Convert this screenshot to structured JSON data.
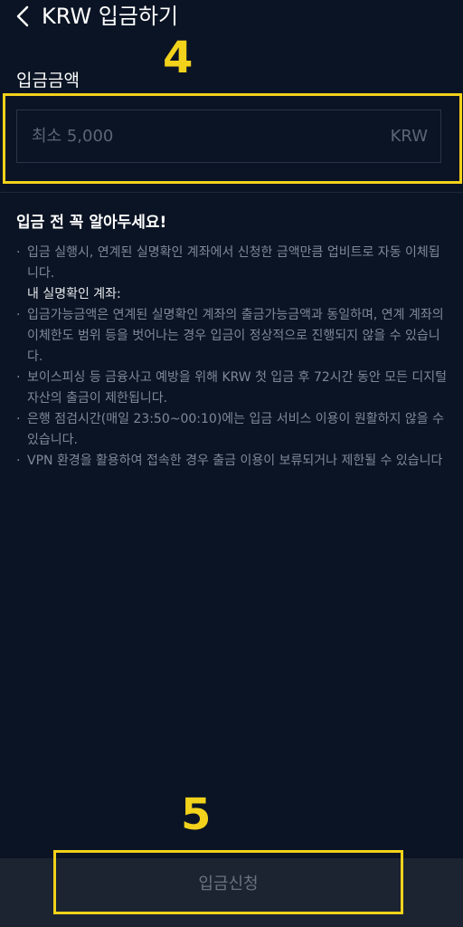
{
  "header": {
    "back_icon": "chevron-left-icon",
    "title": "KRW 입금하기"
  },
  "amount": {
    "label": "입금금액",
    "placeholder": "최소 5,000",
    "unit": "KRW"
  },
  "annotations": {
    "amount_step": "4",
    "submit_step": "5",
    "highlight_color": "#f2d21b"
  },
  "notice": {
    "title": "입금 전 꼭 알아두세요!",
    "items": [
      "입금 실행시, 연계된 실명확인 계좌에서 신청한 금액만큼 업비트로 자동 이체됩니다.",
      "내 실명확인 계좌:",
      "입금가능금액은 연계된 실명확인 계좌의 출금가능금액과 동일하며, 연계 계좌의 이체한도 범위 등을 벗어나는 경우 입금이 정상적으로 진행되지 않을 수 있습니다.",
      "보이스피싱 등 금융사고 예방을 위해 KRW 첫 입금 후 72시간 동안 모든 디지털 자산의 출금이 제한됩니다.",
      "은행 점검시간(매일 23:50~00:10)에는 입금 서비스 이용이 원활하지 않을 수 있습니다.",
      "VPN 환경을 활용하여 접속한 경우 출금 이용이 보류되거나 제한될 수 있습니다"
    ]
  },
  "submit": {
    "label": "입금신청"
  },
  "colors": {
    "background": "#0b1424",
    "bottom_bar": "#1c2431",
    "annotation": "#f2d21b"
  }
}
